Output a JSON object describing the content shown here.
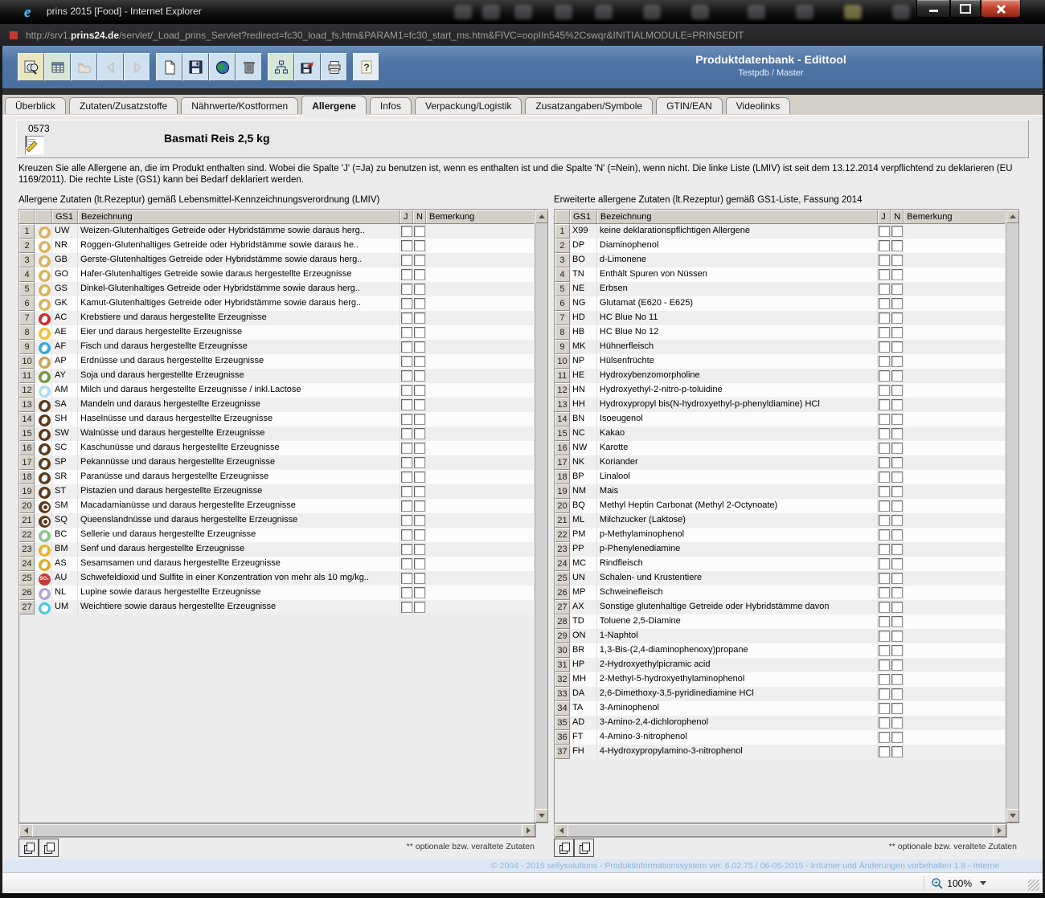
{
  "window": {
    "title": "prins 2015 [Food] - Internet Explorer",
    "url_prefix": "http://srv1.",
    "url_domain": "prins24.de",
    "url_rest": "/servlet/_Load_prins_Servlet?redirect=fc30_load_fs.htm&PARAM1=fc30_start_ms.htm&FIVC=oopIIn545%2Cswqr&INITIALMODULE=PRINSEDIT"
  },
  "header": {
    "app_title": "Produktdatenbank - Edittool",
    "subtitle": "Testpdb / Master"
  },
  "toolbar_icons": [
    "search",
    "table",
    "folder",
    "back",
    "forward",
    "new-document",
    "save",
    "globe",
    "delete",
    "sitemap",
    "export",
    "print",
    "help"
  ],
  "tabs": [
    "Überblick",
    "Zutaten/Zusatzstoffe",
    "Nährwerte/Kostformen",
    "Allergene",
    "Infos",
    "Verpackung/Logistik",
    "Zusatzangaben/Symbole",
    "GTIN/EAN",
    "Videolinks"
  ],
  "active_tab": "Allergene",
  "product": {
    "number": "0573",
    "name": "Basmati Reis 2,5 kg"
  },
  "instructions": "Kreuzen Sie alle Allergene an, die im Produkt enthalten sind. Wobei die Spalte 'J' (=Ja) zu benutzen ist, wenn es enthalten ist und die Spalte 'N' (=Nein), wenn nicht. Die linke Liste (LMIV) ist seit dem 13.12.2014 verpflichtend zu deklarieren (EU 1169/2011). Die rechte Liste (GS1) kann bei Bedarf deklariert werden.",
  "lmiv_table": {
    "caption": "Allergene Zutaten (lt.Rezeptur) gemäß Lebensmittel-Kennzeichnungsverordnung (LMIV)",
    "columns": {
      "gs1": "GS1",
      "name": "Bezeichnung",
      "j": "J",
      "n": "N",
      "remark": "Bemerkung"
    },
    "footnote": "** optionale bzw. veraltete Zutaten",
    "rows": [
      {
        "no": "1",
        "gs1": "UW",
        "name": "Weizen-Glutenhaltiges Getreide oder Hybridstämme sowie daraus herg..",
        "color": "#d9b35c",
        "glyph": ""
      },
      {
        "no": "2",
        "gs1": "NR",
        "name": "Roggen-Glutenhaltiges Getreide oder Hybridstämme sowie daraus he..",
        "color": "#d9b35c",
        "glyph": ""
      },
      {
        "no": "3",
        "gs1": "GB",
        "name": "Gerste-Glutenhaltiges Getreide oder Hybridstämme sowie daraus herg..",
        "color": "#d9b35c",
        "glyph": ""
      },
      {
        "no": "4",
        "gs1": "GO",
        "name": "Hafer-Glutenhaltiges Getreide sowie daraus hergestellte Erzeugnisse",
        "color": "#d9b35c",
        "glyph": ""
      },
      {
        "no": "5",
        "gs1": "GS",
        "name": "Dinkel-Glutenhaltiges Getreide oder Hybridstämme sowie daraus herg..",
        "color": "#d9b35c",
        "glyph": ""
      },
      {
        "no": "6",
        "gs1": "GK",
        "name": "Kamut-Glutenhaltiges Getreide oder Hybridstämme sowie daraus herg..",
        "color": "#d9b35c",
        "glyph": ""
      },
      {
        "no": "7",
        "gs1": "AC",
        "name": "Krebstiere und daraus hergestellte Erzeugnisse",
        "color": "#d32b2b",
        "glyph": ""
      },
      {
        "no": "8",
        "gs1": "AE",
        "name": "Eier und daraus hergestellte Erzeugnisse",
        "color": "#f2c230",
        "glyph": ""
      },
      {
        "no": "9",
        "gs1": "AF",
        "name": "Fisch und daraus hergestellte Erzeugnisse",
        "color": "#35aadf",
        "glyph": ""
      },
      {
        "no": "10",
        "gs1": "AP",
        "name": "Erdnüsse und daraus hergestellte Erzeugnisse",
        "color": "#cda45c",
        "glyph": ""
      },
      {
        "no": "11",
        "gs1": "AY",
        "name": "Soja und daraus hergestellte Erzeugnisse",
        "color": "#6f9940",
        "glyph": ""
      },
      {
        "no": "12",
        "gs1": "AM",
        "name": "Milch und daraus hergestellte Erzeugnisse / inkl.Lactose",
        "color": "#aedded",
        "glyph": ""
      },
      {
        "no": "13",
        "gs1": "SA",
        "name": "Mandeln und daraus hergestellte Erzeugnisse",
        "color": "#5e3a1d",
        "glyph": ""
      },
      {
        "no": "14",
        "gs1": "SH",
        "name": "Haselnüsse und daraus hergestellte Erzeugnisse",
        "color": "#5e3a1d",
        "glyph": ""
      },
      {
        "no": "15",
        "gs1": "SW",
        "name": "Walnüsse und daraus hergestellte Erzeugnisse",
        "color": "#5e3a1d",
        "glyph": ""
      },
      {
        "no": "16",
        "gs1": "SC",
        "name": "Kaschunüsse und daraus hergestellte Erzeugnisse",
        "color": "#5e3a1d",
        "glyph": ""
      },
      {
        "no": "17",
        "gs1": "SP",
        "name": "Pekannüsse und daraus hergestellte Erzeugnisse",
        "color": "#5e3a1d",
        "glyph": ""
      },
      {
        "no": "18",
        "gs1": "SR",
        "name": "Paranüsse und daraus hergestellte Erzeugnisse",
        "color": "#5e3a1d",
        "glyph": ""
      },
      {
        "no": "19",
        "gs1": "ST",
        "name": "Pistazien und daraus hergestellte Erzeugnisse",
        "color": "#5e3a1d",
        "glyph": ""
      },
      {
        "no": "20",
        "gs1": "SM",
        "name": "Macadamianüsse und daraus hergestellte Erzeugnisse",
        "color": "#5e3a1d",
        "glyph": "ring-inner"
      },
      {
        "no": "21",
        "gs1": "SQ",
        "name": "Queenslandnüsse und daraus hergestellte Erzeugnisse",
        "color": "#5e3a1d",
        "glyph": "ring-inner"
      },
      {
        "no": "22",
        "gs1": "BC",
        "name": "Sellerie und daraus hergestellte Erzeugnisse",
        "color": "#8cc48c",
        "glyph": ""
      },
      {
        "no": "23",
        "gs1": "BM",
        "name": "Senf und daraus hergestellte Erzeugnisse",
        "color": "#e8b625",
        "glyph": ""
      },
      {
        "no": "24",
        "gs1": "AS",
        "name": "Sesamsamen und daraus hergestellte Erzeugnisse",
        "color": "#dfac28",
        "glyph": ""
      },
      {
        "no": "25",
        "gs1": "AU",
        "name": "Schwefeldioxid und Sulfite in einer Konzentration von mehr als 10 mg/kg..",
        "color": "#c53b3b",
        "glyph": "SO₂"
      },
      {
        "no": "26",
        "gs1": "NL",
        "name": "Lupine sowie daraus hergestellte Erzeugnisse",
        "color": "#b4a6d6",
        "glyph": ""
      },
      {
        "no": "27",
        "gs1": "UM",
        "name": "Weichtiere sowie daraus hergestellte Erzeugnisse",
        "color": "#4bc8dc",
        "glyph": "ring"
      }
    ]
  },
  "gs1_table": {
    "caption": "Erweiterte allergene Zutaten (lt.Rezeptur) gemäß GS1-Liste, Fassung 2014",
    "columns": {
      "gs1": "GS1",
      "name": "Bezeichnung",
      "j": "J",
      "n": "N",
      "remark": "Bemerkung"
    },
    "footnote": "** optionale bzw. veraltete Zutaten",
    "rows": [
      {
        "no": "1",
        "gs1": "X99",
        "name": "keine deklarationspflichtigen Allergene"
      },
      {
        "no": "2",
        "gs1": "DP",
        "name": "Diaminophenol"
      },
      {
        "no": "3",
        "gs1": "BO",
        "name": "d-Limonene"
      },
      {
        "no": "4",
        "gs1": "TN",
        "name": "Enthält Spuren von Nüssen"
      },
      {
        "no": "5",
        "gs1": "NE",
        "name": "Erbsen"
      },
      {
        "no": "6",
        "gs1": "NG",
        "name": "Glutamat (E620 - E625)"
      },
      {
        "no": "7",
        "gs1": "HD",
        "name": "HC Blue No 11"
      },
      {
        "no": "8",
        "gs1": "HB",
        "name": "HC Blue No 12"
      },
      {
        "no": "9",
        "gs1": "MK",
        "name": "Hühnerfleisch"
      },
      {
        "no": "10",
        "gs1": "NP",
        "name": "Hülsenfrüchte"
      },
      {
        "no": "11",
        "gs1": "HE",
        "name": "Hydroxybenzomorpholine"
      },
      {
        "no": "12",
        "gs1": "HN",
        "name": "Hydroxyethyl-2-nitro-p-toluidine"
      },
      {
        "no": "13",
        "gs1": "HH",
        "name": "Hydroxypropyl bis(N-hydroxyethyl-p-phenyldiamine) HCl"
      },
      {
        "no": "14",
        "gs1": "BN",
        "name": "Isoeugenol"
      },
      {
        "no": "15",
        "gs1": "NC",
        "name": "Kakao"
      },
      {
        "no": "16",
        "gs1": "NW",
        "name": "Karotte"
      },
      {
        "no": "17",
        "gs1": "NK",
        "name": "Koriander"
      },
      {
        "no": "18",
        "gs1": "BP",
        "name": "Linalool"
      },
      {
        "no": "19",
        "gs1": "NM",
        "name": "Mais"
      },
      {
        "no": "20",
        "gs1": "BQ",
        "name": "Methyl Heptin Carbonat (Methyl 2-Octynoate)"
      },
      {
        "no": "21",
        "gs1": "ML",
        "name": "Milchzucker (Laktose)"
      },
      {
        "no": "22",
        "gs1": "PM",
        "name": "p-Methylaminophenol"
      },
      {
        "no": "23",
        "gs1": "PP",
        "name": "p-Phenylenediamine"
      },
      {
        "no": "24",
        "gs1": "MC",
        "name": "Rindfleisch"
      },
      {
        "no": "25",
        "gs1": "UN",
        "name": "Schalen- und Krustentiere"
      },
      {
        "no": "26",
        "gs1": "MP",
        "name": "Schweinefleisch"
      },
      {
        "no": "27",
        "gs1": "AX",
        "name": "Sonstige glutenhaltige Getreide oder Hybridstämme davon"
      },
      {
        "no": "28",
        "gs1": "TD",
        "name": "Toluene 2,5-Diamine"
      },
      {
        "no": "29",
        "gs1": "ON",
        "name": "1-Naphtol"
      },
      {
        "no": "30",
        "gs1": "BR",
        "name": "1,3-Bis-(2,4-diaminophenoxy)propane"
      },
      {
        "no": "31",
        "gs1": "HP",
        "name": "2-Hydroxyethylpicramic acid"
      },
      {
        "no": "32",
        "gs1": "MH",
        "name": "2-Methyl-5-hydroxyethylaminophenol"
      },
      {
        "no": "33",
        "gs1": "DA",
        "name": "2,6-Dimethoxy-3,5-pyridinediamine HCl"
      },
      {
        "no": "34",
        "gs1": "TA",
        "name": "3-Aminophenol"
      },
      {
        "no": "35",
        "gs1": "AD",
        "name": "3-Amino-2,4-dichlorophenol"
      },
      {
        "no": "36",
        "gs1": "FT",
        "name": "4-Amino-3-nitrophenol"
      },
      {
        "no": "37",
        "gs1": "FH",
        "name": "4-Hydroxypropylamino-3-nitrophenol"
      }
    ]
  },
  "footer": {
    "copyright": "© 2004 - 2015 sellysolutions - Produktinformationssystem ver. 6.02.75 / 06-05-2015 - Irrtümer und Änderungen vorbehalten  1.8 - Interne"
  },
  "statusbar": {
    "zoom": "100%"
  },
  "colors": {
    "toolbar_blue": "#4d74a4",
    "footer_blue": "#dbe7f5",
    "panel_gray": "#ececec"
  }
}
